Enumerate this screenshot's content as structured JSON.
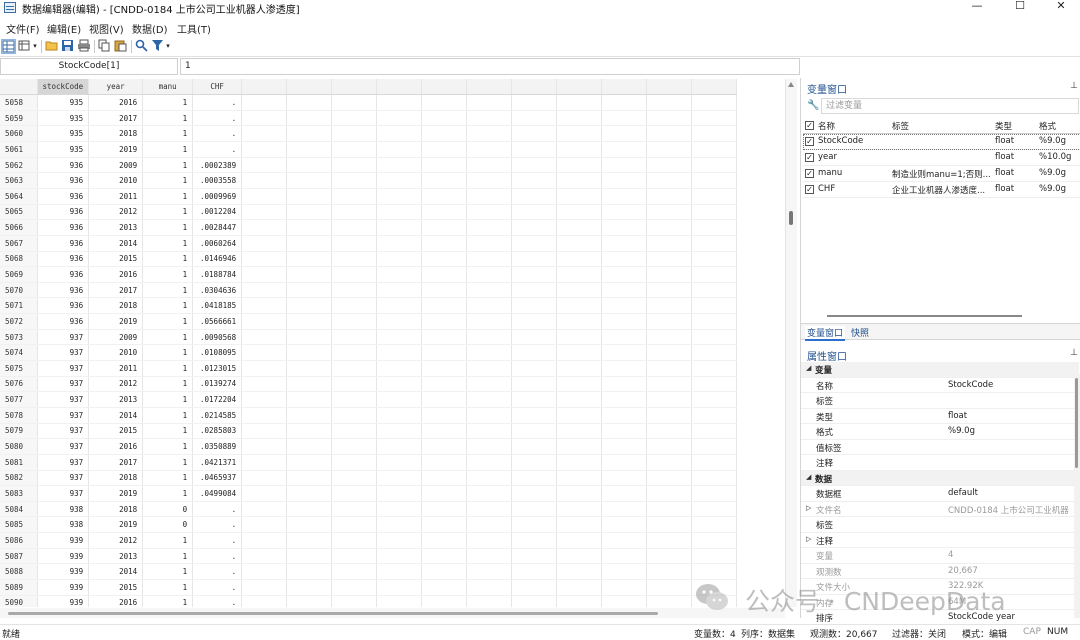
{
  "window": {
    "title": "数据编辑器(编辑) - [CNDD-0184 上市公司工业机器人渗透度]",
    "controls": [
      "—",
      "☐",
      "✕"
    ]
  },
  "menu": [
    "文件(F)",
    "编辑(E)",
    "视图(V)",
    "数据(D)",
    "工具(T)"
  ],
  "toolbar": {
    "icons": [
      "data-editor-view-icon",
      "variables-manager-icon",
      "open-icon",
      "save-icon",
      "print-icon",
      "copy-icon",
      "paste-icon",
      "find-icon",
      "filter-icon"
    ]
  },
  "cellbox": {
    "varname": "StockCode[1]",
    "value": "1"
  },
  "grid": {
    "columns": [
      "stockCode",
      "year",
      "manu",
      "CHF"
    ],
    "rows": [
      [
        "5058",
        "935",
        "2016",
        "1",
        "."
      ],
      [
        "5059",
        "935",
        "2017",
        "1",
        "."
      ],
      [
        "5060",
        "935",
        "2018",
        "1",
        "."
      ],
      [
        "5061",
        "935",
        "2019",
        "1",
        "."
      ],
      [
        "5062",
        "936",
        "2009",
        "1",
        ".0002389"
      ],
      [
        "5063",
        "936",
        "2010",
        "1",
        ".0003558"
      ],
      [
        "5064",
        "936",
        "2011",
        "1",
        ".0009969"
      ],
      [
        "5065",
        "936",
        "2012",
        "1",
        ".0012204"
      ],
      [
        "5066",
        "936",
        "2013",
        "1",
        ".0028447"
      ],
      [
        "5067",
        "936",
        "2014",
        "1",
        ".0060264"
      ],
      [
        "5068",
        "936",
        "2015",
        "1",
        ".0146946"
      ],
      [
        "5069",
        "936",
        "2016",
        "1",
        ".0188784"
      ],
      [
        "5070",
        "936",
        "2017",
        "1",
        ".0304636"
      ],
      [
        "5071",
        "936",
        "2018",
        "1",
        ".0418185"
      ],
      [
        "5072",
        "936",
        "2019",
        "1",
        ".0566661"
      ],
      [
        "5073",
        "937",
        "2009",
        "1",
        ".0090568"
      ],
      [
        "5074",
        "937",
        "2010",
        "1",
        ".0108095"
      ],
      [
        "5075",
        "937",
        "2011",
        "1",
        ".0123015"
      ],
      [
        "5076",
        "937",
        "2012",
        "1",
        ".0139274"
      ],
      [
        "5077",
        "937",
        "2013",
        "1",
        ".0172204"
      ],
      [
        "5078",
        "937",
        "2014",
        "1",
        ".0214585"
      ],
      [
        "5079",
        "937",
        "2015",
        "1",
        ".0285803"
      ],
      [
        "5080",
        "937",
        "2016",
        "1",
        ".0350889"
      ],
      [
        "5081",
        "937",
        "2017",
        "1",
        ".0421371"
      ],
      [
        "5082",
        "937",
        "2018",
        "1",
        ".0465937"
      ],
      [
        "5083",
        "937",
        "2019",
        "1",
        ".0499084"
      ],
      [
        "5084",
        "938",
        "2018",
        "0",
        "."
      ],
      [
        "5085",
        "938",
        "2019",
        "0",
        "."
      ],
      [
        "5086",
        "939",
        "2012",
        "1",
        "."
      ],
      [
        "5087",
        "939",
        "2013",
        "1",
        "."
      ],
      [
        "5088",
        "939",
        "2014",
        "1",
        "."
      ],
      [
        "5089",
        "939",
        "2015",
        "1",
        "."
      ],
      [
        "5090",
        "939",
        "2016",
        "1",
        "."
      ]
    ]
  },
  "variables_window": {
    "title": "变量窗口",
    "filter_placeholder": "过滤变量",
    "headers": [
      "名称",
      "标签",
      "类型",
      "格式"
    ],
    "variables": [
      {
        "name": "StockCode",
        "label": "",
        "type": "float",
        "format": "%9.0g"
      },
      {
        "name": "year",
        "label": "",
        "type": "float",
        "format": "%10.0g"
      },
      {
        "name": "manu",
        "label": "制造业则manu=1;否则...",
        "type": "float",
        "format": "%9.0g"
      },
      {
        "name": "CHF",
        "label": "企业工业机器人渗透度...",
        "type": "float",
        "format": "%9.0g"
      }
    ],
    "tabs": [
      "变量窗口",
      "快照"
    ]
  },
  "properties_window": {
    "title": "属性窗口",
    "groups": [
      {
        "name": "变量",
        "rows": [
          {
            "key": "名称",
            "value": "StockCode"
          },
          {
            "key": "标签",
            "value": ""
          },
          {
            "key": "类型",
            "value": "float"
          },
          {
            "key": "格式",
            "value": "%9.0g"
          },
          {
            "key": "值标签",
            "value": ""
          },
          {
            "key": "注释",
            "value": ""
          }
        ]
      },
      {
        "name": "数据",
        "rows": [
          {
            "key": "数据框",
            "value": "default"
          },
          {
            "key": "文件名",
            "value": "CNDD-0184 上市公司工业机器",
            "expand": true,
            "dim": true
          },
          {
            "key": "标签",
            "value": ""
          },
          {
            "key": "注释",
            "value": "",
            "expand": true
          },
          {
            "key": "变量",
            "value": "4",
            "dim": true
          },
          {
            "key": "观测数",
            "value": "20,667",
            "dim": true
          },
          {
            "key": "文件大小",
            "value": "322.92K",
            "dim": true
          },
          {
            "key": "内存",
            "value": "64M",
            "dim": true
          },
          {
            "key": "排序",
            "value": "StockCode year"
          }
        ]
      }
    ]
  },
  "statusbar": {
    "left": "就绪",
    "vars": "变量数：4",
    "order": "列序：数据集",
    "obs": "观测数：20,667",
    "filter": "过滤器：关闭",
    "mode": "模式：编辑",
    "cap": "CAP",
    "num": "NUM"
  },
  "watermark": {
    "text": "公众号 · CNDeepData"
  }
}
